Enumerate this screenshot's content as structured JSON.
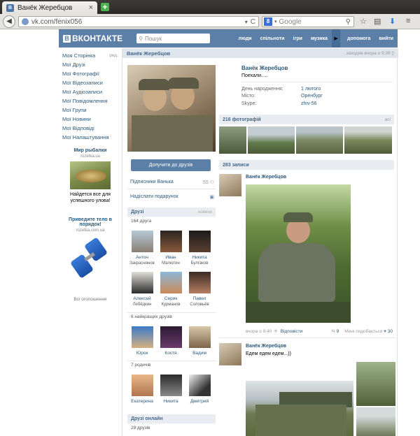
{
  "browser": {
    "tab_title": "Ванёк Жеребцов",
    "url": "vk.com/fenix056",
    "search_placeholder": "Google"
  },
  "vk": {
    "logo_text": "ВКОНТАКТЕ",
    "search_placeholder": "Пошук",
    "nav": [
      "люди",
      "спільноти",
      "ігри",
      "музика",
      "допомога",
      "вийти"
    ]
  },
  "left_menu": {
    "items": [
      "Моя Сторінка",
      "Мої Друзі",
      "Мої Фотографії",
      "Мої Відеозаписи",
      "Мої Аудіозаписи",
      "Мої Повідомлення",
      "Мої Групи",
      "Мої Новини",
      "Мої Відповіді",
      "Мої Налаштування"
    ],
    "edit_label": "ред."
  },
  "ads": [
    {
      "title": "Мир рыбалки",
      "site": "rozetka.ua",
      "desc": "Найдется все для успешного улова!"
    },
    {
      "title": "Приведите тело в порядок!",
      "site": "rozetka.com.ua",
      "desc": ""
    }
  ],
  "all_ads": "Всі оголошення",
  "profile": {
    "name": "Ванёк Жеребцов",
    "online": "заходив вчора о 9:39",
    "status": "Поехали.....",
    "info": [
      {
        "k": "День народження:",
        "v": "1 лютого"
      },
      {
        "k": "Місто:",
        "v": "Оренбург"
      },
      {
        "k": "Skype:",
        "v": "zhiv-56"
      }
    ],
    "add_friend": "Допучити до друзів",
    "subscribers_label": "Підписники Ванька",
    "subscribers_count": "55",
    "send_gift": "Надіслати подарунок"
  },
  "friends": {
    "title": "Друзі",
    "news": "новини",
    "count": "164 друга",
    "items": [
      {
        "name": "Антон",
        "last": "Закраснянов"
      },
      {
        "name": "Иван",
        "last": "Малютин"
      },
      {
        "name": "Никита",
        "last": "Булгаков"
      },
      {
        "name": "Алексей",
        "last": "Лебёдкин"
      },
      {
        "name": "Серик",
        "last": "Курманов"
      },
      {
        "name": "Павел",
        "last": "Соловьёв"
      }
    ],
    "close_label": "6 найкращих друзів",
    "close": [
      "Юрок",
      "Костя",
      "Вадим"
    ],
    "relatives_label": "7 родичів",
    "relatives": [
      "Екатерина",
      "Никита",
      "Дмитрий"
    ],
    "online_title": "Друзі онлайн",
    "online_count": "28 друзів"
  },
  "photos": {
    "title": "216 фотографій",
    "all": "всі"
  },
  "wall": {
    "title": "283 записи",
    "posts": [
      {
        "author": "Ванёк Жеребцов",
        "text": "",
        "time": "вчора о 9:40",
        "reply": "Відповісти",
        "reposts": "9",
        "likes_label": "Мені подобається",
        "likes": "30"
      },
      {
        "author": "Ванёк Жеребцов",
        "text": "Едем едем едем...))"
      }
    ]
  },
  "colors": {
    "header": "#5b7fa6",
    "link": "#2b587a",
    "section": "#e9edf1"
  }
}
